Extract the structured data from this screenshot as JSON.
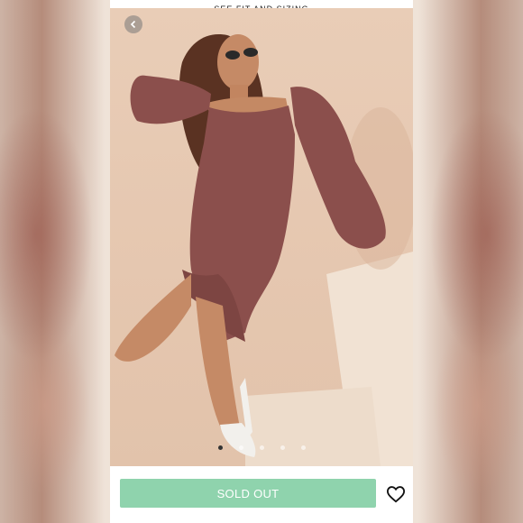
{
  "header": {
    "link_label": "SEE FIT AND SIZING"
  },
  "gallery": {
    "image_count": 5,
    "active_index": 0,
    "description_icon": "chevron-left-icon"
  },
  "actions": {
    "sold_out_label": "SOLD OUT",
    "favorite_icon": "heart-outline-icon"
  },
  "colors": {
    "button": "#8fd3ad",
    "dress": "#8b4f4c",
    "backdrop": "#e8cbb4"
  }
}
